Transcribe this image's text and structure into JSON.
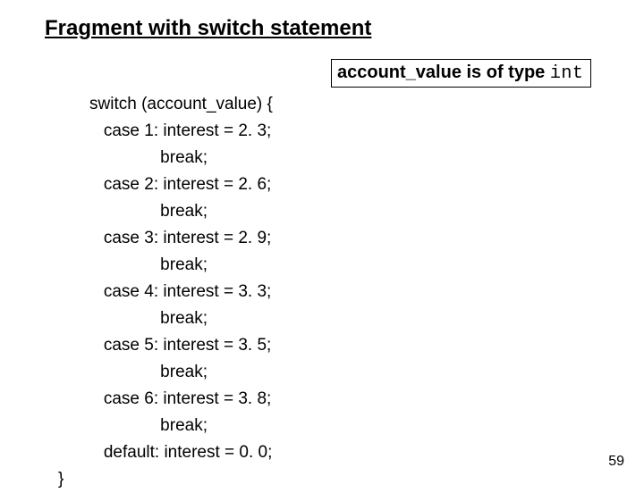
{
  "title": "Fragment with switch statement",
  "code": {
    "l1": "switch (account_value) {",
    "l2": "   case 1: interest = 2. 3;",
    "l3": "               break;",
    "l4": "   case 2: interest = 2. 6;",
    "l5": "               break;",
    "l6": "   case 3: interest = 2. 9;",
    "l7": "               break;",
    "l8": "   case 4: interest = 3. 3;",
    "l9": "               break;",
    "l10": "   case 5: interest = 3. 5;",
    "l11": "               break;",
    "l12": "   case 6: interest = 3. 8;",
    "l13": "               break;",
    "l14": "   default: interest = 0. 0;",
    "l15": "}"
  },
  "note": {
    "prefix": "account_value is of type ",
    "type": "int"
  },
  "page": "59"
}
